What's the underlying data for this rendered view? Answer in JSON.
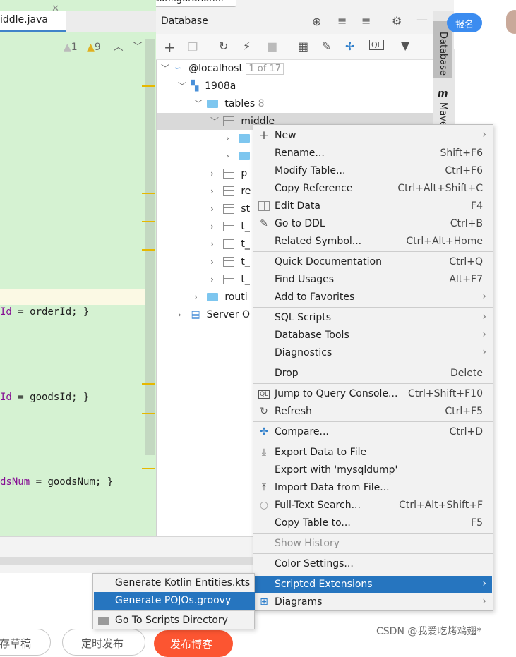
{
  "top": {
    "run_config": "Add Configuration..."
  },
  "editor": {
    "tab_label": "iddle.java",
    "warnings": "1",
    "weak_warnings": "9",
    "code_lines": [
      {
        "field": "Id",
        "rest": " = orderId; }"
      },
      {
        "field": "Id",
        "rest": " = goodsId; }"
      },
      {
        "field": "dsNum",
        "rest": " = goodsNum; }"
      }
    ]
  },
  "database": {
    "title": "Database",
    "side_tab": "Database",
    "side_tab2": "Maven",
    "tree": {
      "host": "@localhost",
      "host_badge": "1 of 17",
      "schema": "1908a",
      "tables_label": "tables",
      "tables_count": "8",
      "selected_table": "middle",
      "rows": [
        "p",
        "re",
        "st",
        "t_",
        "t_",
        "t_",
        "t_"
      ],
      "routines": "routi",
      "server_objects": "Server O"
    }
  },
  "browser": {
    "report_button": "报名",
    "pill_1": "存草稿",
    "pill_2": "定时发布",
    "publish_button": "发布博客",
    "watermark": "CSDN @我爱吃烤鸡翅*"
  },
  "context_menu": {
    "items": [
      {
        "label": "New",
        "shortcut": "",
        "submenu": true,
        "icon": "plus-icon"
      },
      {
        "label": "Rename...",
        "shortcut": "Shift+F6"
      },
      {
        "label": "Modify Table...",
        "shortcut": "Ctrl+F6"
      },
      {
        "label": "Copy Reference",
        "shortcut": "Ctrl+Alt+Shift+C"
      },
      {
        "label": "Edit Data",
        "shortcut": "F4",
        "icon": "table-icon"
      },
      {
        "label": "Go to DDL",
        "shortcut": "Ctrl+B",
        "icon": "pencil-icon"
      },
      {
        "label": "Related Symbol...",
        "shortcut": "Ctrl+Alt+Home"
      },
      {
        "label": "Quick Documentation",
        "shortcut": "Ctrl+Q"
      },
      {
        "label": "Find Usages",
        "shortcut": "Alt+F7"
      },
      {
        "label": "Add to Favorites",
        "shortcut": "",
        "submenu": true
      },
      {
        "label": "SQL Scripts",
        "shortcut": "",
        "submenu": true
      },
      {
        "label": "Database Tools",
        "shortcut": "",
        "submenu": true
      },
      {
        "label": "Diagnostics",
        "shortcut": "",
        "submenu": true
      },
      {
        "label": "Drop",
        "shortcut": "Delete"
      },
      {
        "label": "Jump to Query Console...",
        "shortcut": "Ctrl+Shift+F10",
        "icon": "ql-icon"
      },
      {
        "label": "Refresh",
        "shortcut": "Ctrl+F5",
        "icon": "refresh-icon"
      },
      {
        "label": "Compare...",
        "shortcut": "Ctrl+D",
        "icon": "compare-icon"
      },
      {
        "label": "Export Data to File",
        "shortcut": "",
        "icon": "download-icon"
      },
      {
        "label": "Export with 'mysqldump'",
        "shortcut": ""
      },
      {
        "label": "Import Data from File...",
        "shortcut": "",
        "icon": "upload-icon"
      },
      {
        "label": "Full-Text Search...",
        "shortcut": "Ctrl+Alt+Shift+F",
        "icon": "search-icon"
      },
      {
        "label": "Copy Table to...",
        "shortcut": "F5"
      },
      {
        "label": "Show History",
        "shortcut": "",
        "disabled": true
      },
      {
        "label": "Color Settings...",
        "shortcut": ""
      },
      {
        "label": "Scripted Extensions",
        "shortcut": "",
        "submenu": true,
        "highlighted": true
      },
      {
        "label": "Diagrams",
        "shortcut": "",
        "submenu": true,
        "icon": "diagram-icon"
      }
    ]
  },
  "submenu": {
    "items": [
      {
        "label": "Generate Kotlin Entities.kts"
      },
      {
        "label": "Generate POJOs.groovy",
        "highlighted": true
      },
      {
        "label": "Go To Scripts Directory",
        "icon": "folder-icon"
      }
    ]
  },
  "colors": {
    "highlight": "#2675bf",
    "editor_bg": "#d5f2d2",
    "publish": "#fc5531"
  }
}
